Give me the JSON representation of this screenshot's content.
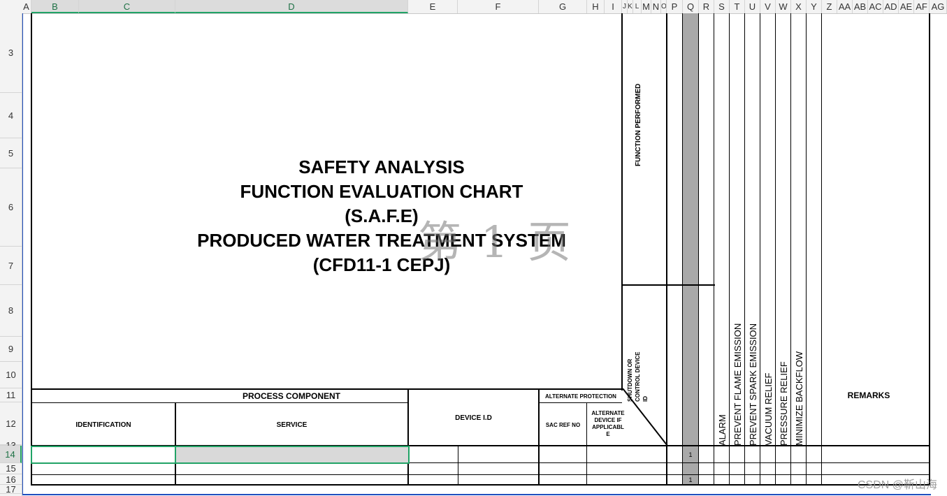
{
  "columns": [
    "A",
    "B",
    "C",
    "D",
    "E",
    "F",
    "G",
    "H",
    "I",
    "J",
    "K",
    "L",
    "M",
    "N",
    "O",
    "P",
    "Q",
    "R",
    "S",
    "T",
    "U",
    "V",
    "W",
    "X",
    "Y",
    "Z",
    "AA",
    "AB",
    "AC",
    "AD",
    "AE",
    "AF",
    "AG"
  ],
  "rows": [
    "3",
    "4",
    "5",
    "6",
    "7",
    "8",
    "9",
    "10",
    "11",
    "12",
    "13",
    "14",
    "15",
    "16",
    "17"
  ],
  "title_lines": [
    "SAFETY ANALYSIS",
    "FUNCTION EVALUATION CHART",
    "(S.A.F.E)",
    "PRODUCED WATER TREATMENT SYSTEM",
    "(CFD11-1 CEPJ)"
  ],
  "watermark": "第 1 页",
  "function_performed": "FUNCTION PERFORMED",
  "shutdown_label": "SHUTDOWN OR CONTROL DEVICE ID",
  "process_component": "PROCESS COMPONENT",
  "identification": "IDENTIFICATION",
  "service": "SERVICE",
  "device_id": "DEVICE I.D",
  "alternate_protection": "ALTERNATE PROTECTION",
  "sac_ref_no": "SAC REF NO",
  "alternate_device": "ALTERNATE DEVICE IF APPLICABLE",
  "alternate_device_lines": [
    "ALTERNATE",
    "DEVICE IF",
    "APPLICABL",
    "E"
  ],
  "functions": [
    "ALARM",
    "PREVENT FLAME EMISSION",
    "PREVENT SPARK EMISSION",
    "VACUUM RELIEF",
    "PRESSURE RELIEF",
    "MINIMIZE BACKFLOW"
  ],
  "remarks": "REMARKS",
  "q_values": [
    "1",
    "1"
  ],
  "csdn_watermark": "CSDN @靳山海"
}
